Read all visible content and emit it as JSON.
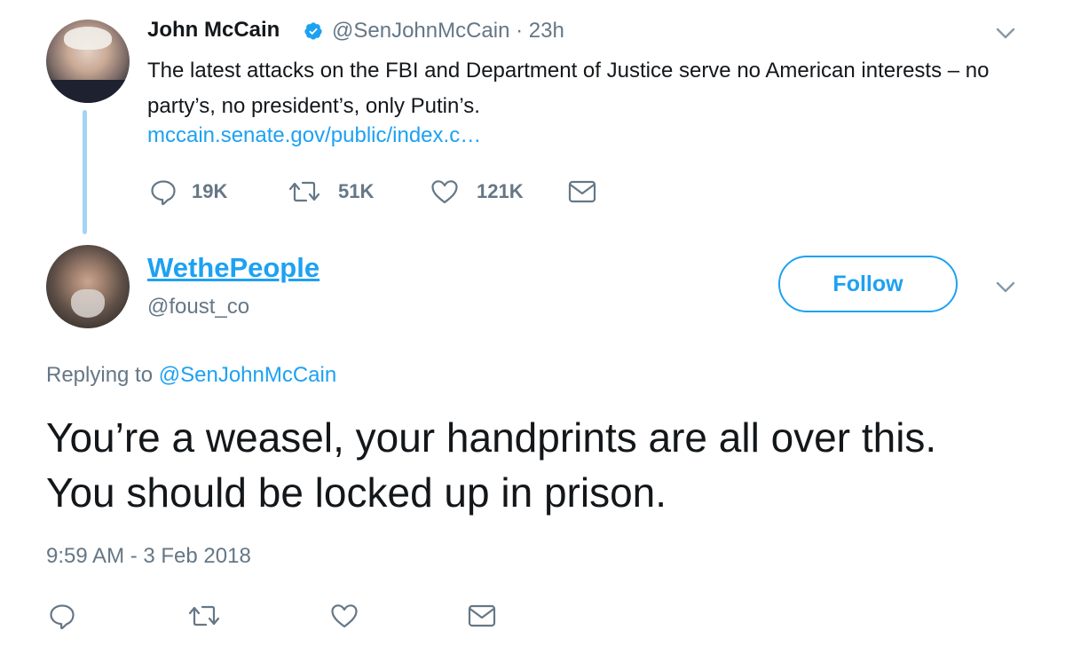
{
  "parent_tweet": {
    "name": "John McCain",
    "handle": "@SenJohnMcCain",
    "time": "23h",
    "meta": "@SenJohnMcCain · 23h",
    "text": "The latest attacks on the FBI and Department of Justice serve no American interests – no party’s, no president’s, only Putin’s.",
    "link": "mccain.senate.gov/public/index.c…",
    "actions": {
      "replies": "19K",
      "retweets": "51K",
      "likes": "121K"
    },
    "verified": true
  },
  "reply_tweet": {
    "name": "WethePeople",
    "handle": "@foust_co",
    "follow_label": "Follow",
    "replying_prefix": "Replying to ",
    "replying_to": "@SenJohnMcCain",
    "text": "You’re a weasel, your handprints are all over this.   You should be locked up in prison.",
    "timestamp": "9:59 AM - 3 Feb 2018"
  },
  "icons": {
    "reply": "reply-icon",
    "retweet": "retweet-icon",
    "like": "heart-icon",
    "dm": "envelope-icon",
    "menu": "chevron-down-icon",
    "verified": "verified-badge-icon"
  },
  "colors": {
    "accent": "#1da1f2",
    "text": "#14171a",
    "secondary": "#657786",
    "thread_line": "#a4d4f5"
  }
}
